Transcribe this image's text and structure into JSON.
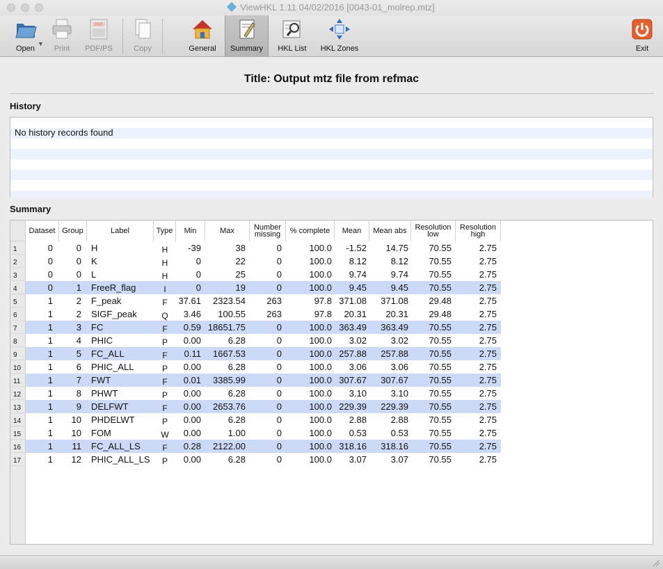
{
  "window": {
    "title": "ViewHKL 1.11 04/02/2016 [0043-01_molrep.mtz]"
  },
  "toolbar": {
    "open": "Open",
    "print": "Print",
    "pdfps": "PDF/PS",
    "copy": "Copy",
    "general": "General",
    "summary": "Summary",
    "hkl_list": "HKL List",
    "hkl_zones": "HKL Zones",
    "exit": "Exit",
    "pdf_icon_text": "PDF"
  },
  "doc": {
    "title": "Title: Output mtz file from refmac"
  },
  "history": {
    "label": "History",
    "text": "No history records found"
  },
  "summary": {
    "label": "Summary",
    "headers": [
      [
        "Dataset",
        ""
      ],
      [
        "Group",
        ""
      ],
      [
        "Label",
        ""
      ],
      [
        "Type",
        ""
      ],
      [
        "Min",
        ""
      ],
      [
        "Max",
        ""
      ],
      [
        "Number",
        "missing"
      ],
      [
        "% complete",
        ""
      ],
      [
        "Mean",
        ""
      ],
      [
        "Mean abs",
        ""
      ],
      [
        "Resolution",
        "low"
      ],
      [
        "Resolution",
        "high"
      ]
    ],
    "selected_rows": [
      4,
      7,
      9,
      11,
      13,
      16
    ],
    "rows": [
      [
        "0",
        "0",
        "H",
        "H",
        "-39",
        "38",
        "0",
        "100.0",
        "-1.52",
        "14.75",
        "70.55",
        "2.75"
      ],
      [
        "0",
        "0",
        "K",
        "H",
        "0",
        "22",
        "0",
        "100.0",
        "8.12",
        "8.12",
        "70.55",
        "2.75"
      ],
      [
        "0",
        "0",
        "L",
        "H",
        "0",
        "25",
        "0",
        "100.0",
        "9.74",
        "9.74",
        "70.55",
        "2.75"
      ],
      [
        "0",
        "1",
        "FreeR_flag",
        "I",
        "0",
        "19",
        "0",
        "100.0",
        "9.45",
        "9.45",
        "70.55",
        "2.75"
      ],
      [
        "1",
        "2",
        "F_peak",
        "F",
        "37.61",
        "2323.54",
        "263",
        "97.8",
        "371.08",
        "371.08",
        "29.48",
        "2.75"
      ],
      [
        "1",
        "2",
        "SIGF_peak",
        "Q",
        "3.46",
        "100.55",
        "263",
        "97.8",
        "20.31",
        "20.31",
        "29.48",
        "2.75"
      ],
      [
        "1",
        "3",
        "FC",
        "F",
        "0.59",
        "18651.75",
        "0",
        "100.0",
        "363.49",
        "363.49",
        "70.55",
        "2.75"
      ],
      [
        "1",
        "4",
        "PHIC",
        "P",
        "0.00",
        "6.28",
        "0",
        "100.0",
        "3.02",
        "3.02",
        "70.55",
        "2.75"
      ],
      [
        "1",
        "5",
        "FC_ALL",
        "F",
        "0.11",
        "1667.53",
        "0",
        "100.0",
        "257.88",
        "257.88",
        "70.55",
        "2.75"
      ],
      [
        "1",
        "6",
        "PHIC_ALL",
        "P",
        "0.00",
        "6.28",
        "0",
        "100.0",
        "3.06",
        "3.06",
        "70.55",
        "2.75"
      ],
      [
        "1",
        "7",
        "FWT",
        "F",
        "0.01",
        "3385.99",
        "0",
        "100.0",
        "307.67",
        "307.67",
        "70.55",
        "2.75"
      ],
      [
        "1",
        "8",
        "PHWT",
        "P",
        "0.00",
        "6.28",
        "0",
        "100.0",
        "3.10",
        "3.10",
        "70.55",
        "2.75"
      ],
      [
        "1",
        "9",
        "DELFWT",
        "F",
        "0.00",
        "2653.76",
        "0",
        "100.0",
        "229.39",
        "229.39",
        "70.55",
        "2.75"
      ],
      [
        "1",
        "10",
        "PHDELWT",
        "P",
        "0.00",
        "6.28",
        "0",
        "100.0",
        "2.88",
        "2.88",
        "70.55",
        "2.75"
      ],
      [
        "1",
        "10",
        "FOM",
        "W",
        "0.00",
        "1.00",
        "0",
        "100.0",
        "0.53",
        "0.53",
        "70.55",
        "2.75"
      ],
      [
        "1",
        "11",
        "FC_ALL_LS",
        "F",
        "0.28",
        "2122.00",
        "0",
        "100.0",
        "318.16",
        "318.16",
        "70.55",
        "2.75"
      ],
      [
        "1",
        "12",
        "PHIC_ALL_LS",
        "P",
        "0.00",
        "6.28",
        "0",
        "100.0",
        "3.07",
        "3.07",
        "70.55",
        "2.75"
      ]
    ]
  }
}
